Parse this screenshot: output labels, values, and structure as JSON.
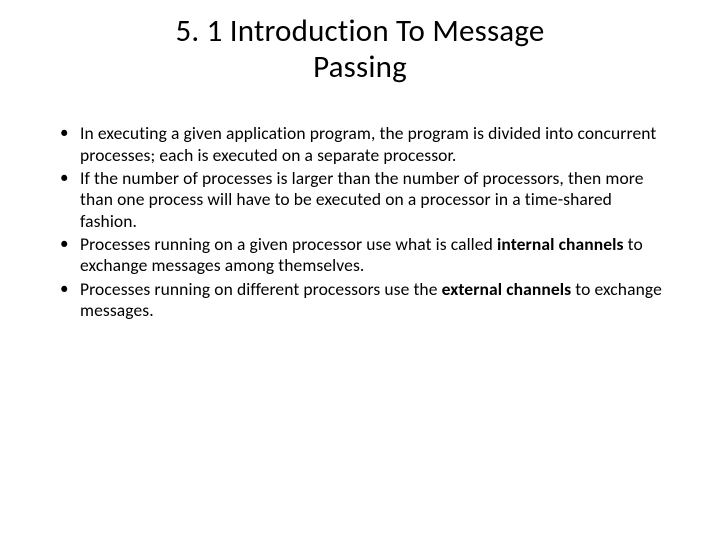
{
  "title_line1": "5. 1 Introduction To Message",
  "title_line2": "Passing",
  "bullets": [
    {
      "pre": "In executing a given application program, the program is divided into concurrent processes; each is executed on a separate processor.",
      "bold": "",
      "post": ""
    },
    {
      "pre": "If the number of processes is larger than the number of processors, then more than one process will have to be executed on a processor in a time-shared fashion.",
      "bold": "",
      "post": ""
    },
    {
      "pre": "Processes running on a given processor use what is called ",
      "bold": "internal channels",
      "post": " to exchange messages among themselves."
    },
    {
      "pre": "Processes running on different processors use the ",
      "bold": "external channels",
      "post": " to exchange messages."
    }
  ]
}
